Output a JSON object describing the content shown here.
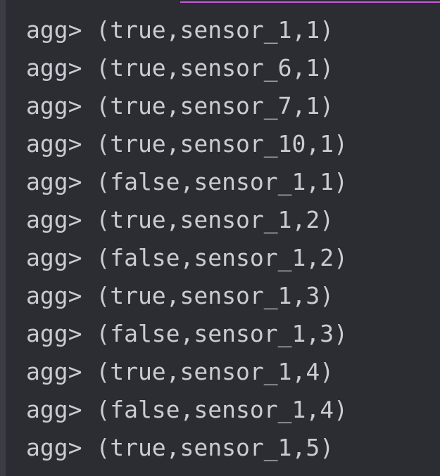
{
  "console": {
    "lines": [
      "agg> (true,sensor_1,1)",
      "agg> (true,sensor_6,1)",
      "agg> (true,sensor_7,1)",
      "agg> (true,sensor_10,1)",
      "agg> (false,sensor_1,1)",
      "agg> (true,sensor_1,2)",
      "agg> (false,sensor_1,2)",
      "agg> (true,sensor_1,3)",
      "agg> (false,sensor_1,3)",
      "agg> (true,sensor_1,4)",
      "agg> (false,sensor_1,4)",
      "agg> (true,sensor_1,5)"
    ]
  },
  "colors": {
    "background": "#2b2d33",
    "text": "#c9ccd2",
    "link_underline": "#c65bd6"
  }
}
